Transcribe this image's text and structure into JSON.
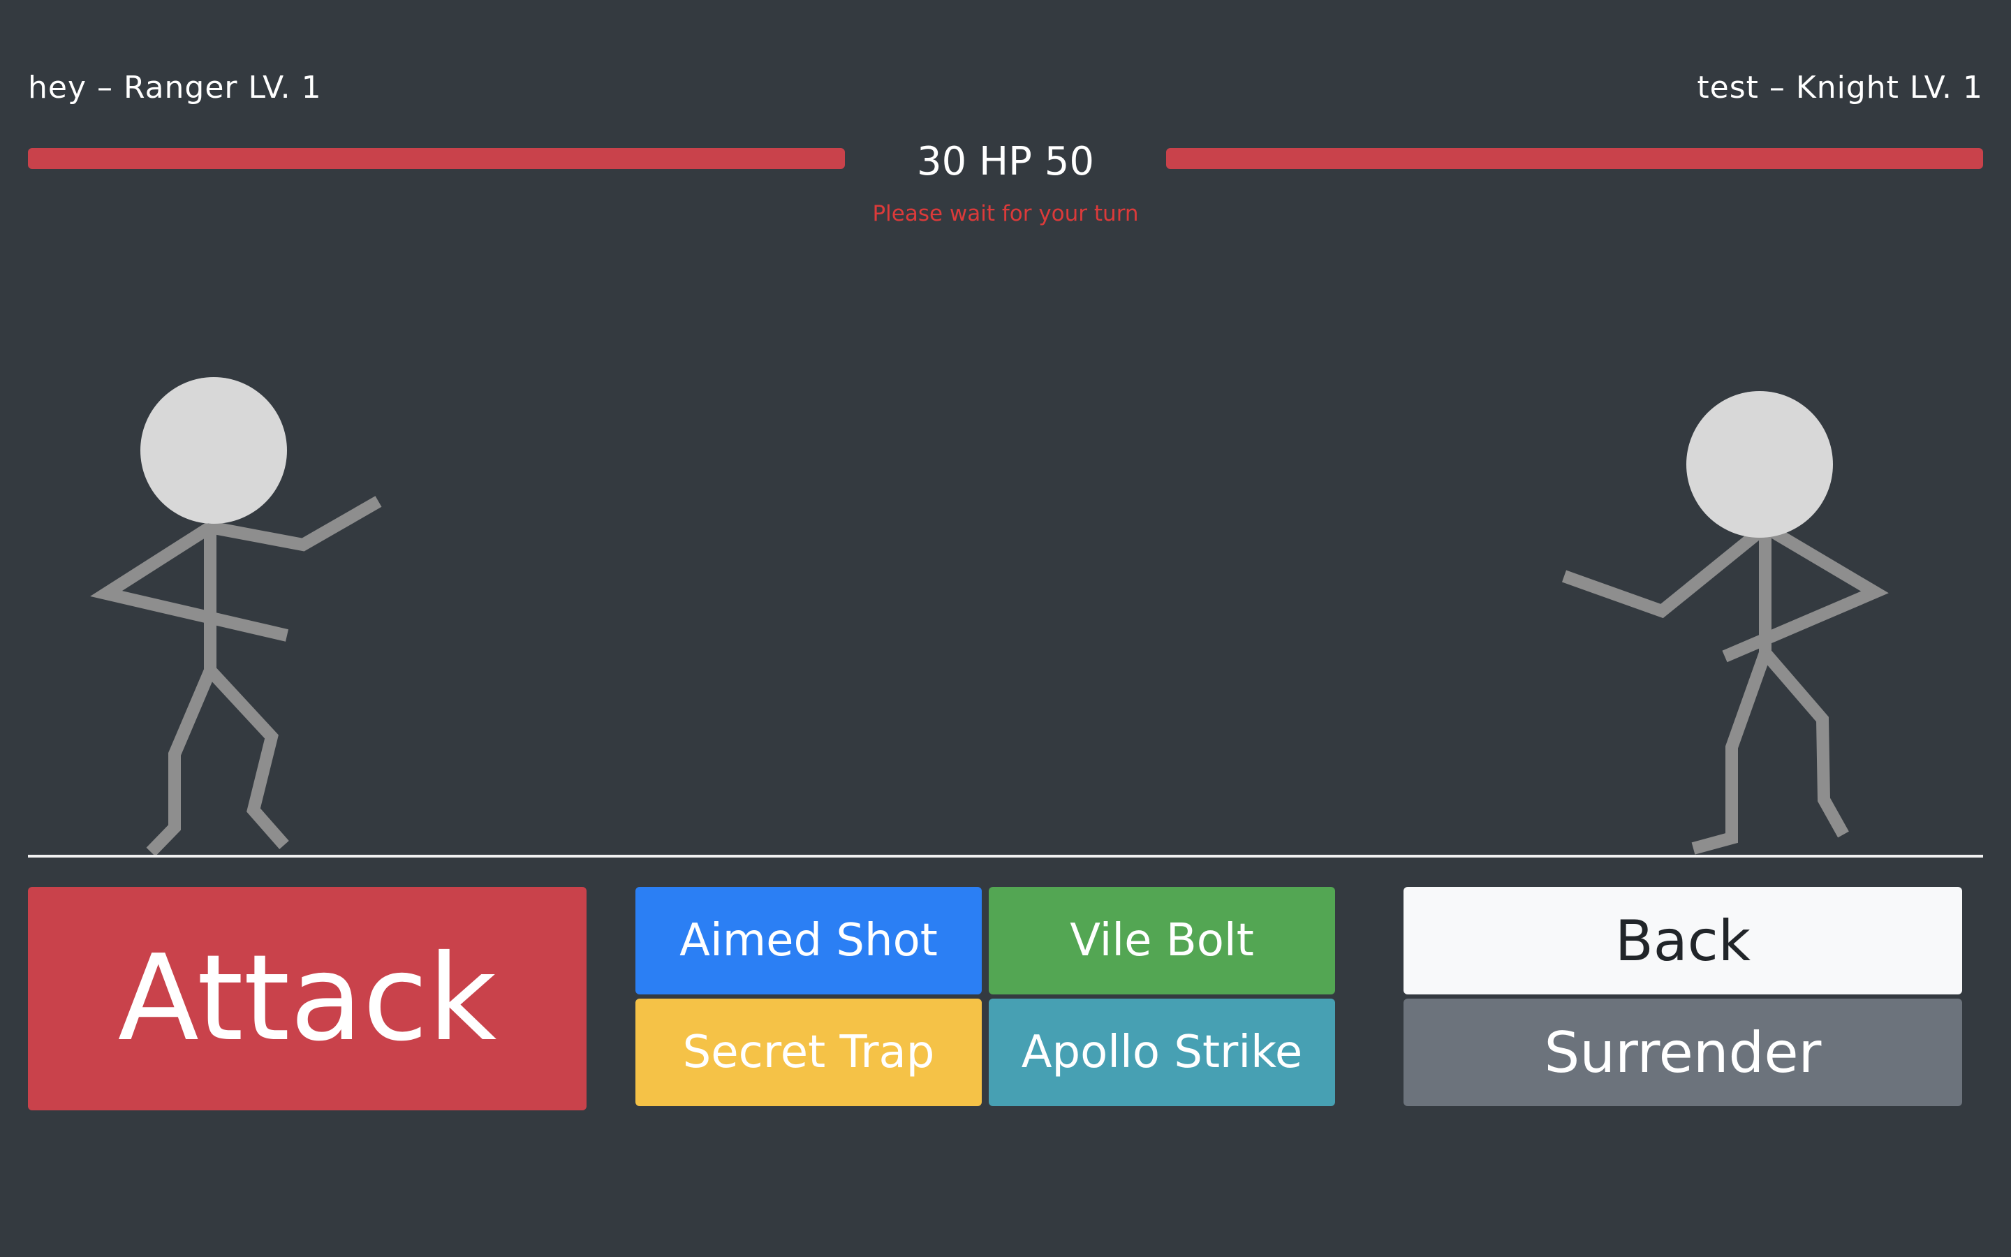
{
  "players": {
    "left": {
      "label": "hey – Ranger LV. 1",
      "hp_fraction": 1.0
    },
    "right": {
      "label": "test – Knight LV. 1",
      "hp_fraction": 1.0
    }
  },
  "hp_readout": "30 HP 50",
  "status": "Please wait for your turn",
  "actions": {
    "attack_label": "Attack",
    "skills": [
      "Aimed Shot",
      "Vile Bolt",
      "Secret Trap",
      "Apollo Strike"
    ],
    "back_label": "Back",
    "surrender_label": "Surrender"
  },
  "colors": {
    "background": "#343a40",
    "hp_fill": "#c9424b",
    "status_text": "#dc3a3a",
    "attack": "#c9424b",
    "skill_blue": "#2b7ff4",
    "skill_green": "#53a653",
    "skill_yellow": "#f5c247",
    "skill_teal": "#47a0b3",
    "back": "#f8f9fa",
    "surrender": "#6c737c"
  }
}
